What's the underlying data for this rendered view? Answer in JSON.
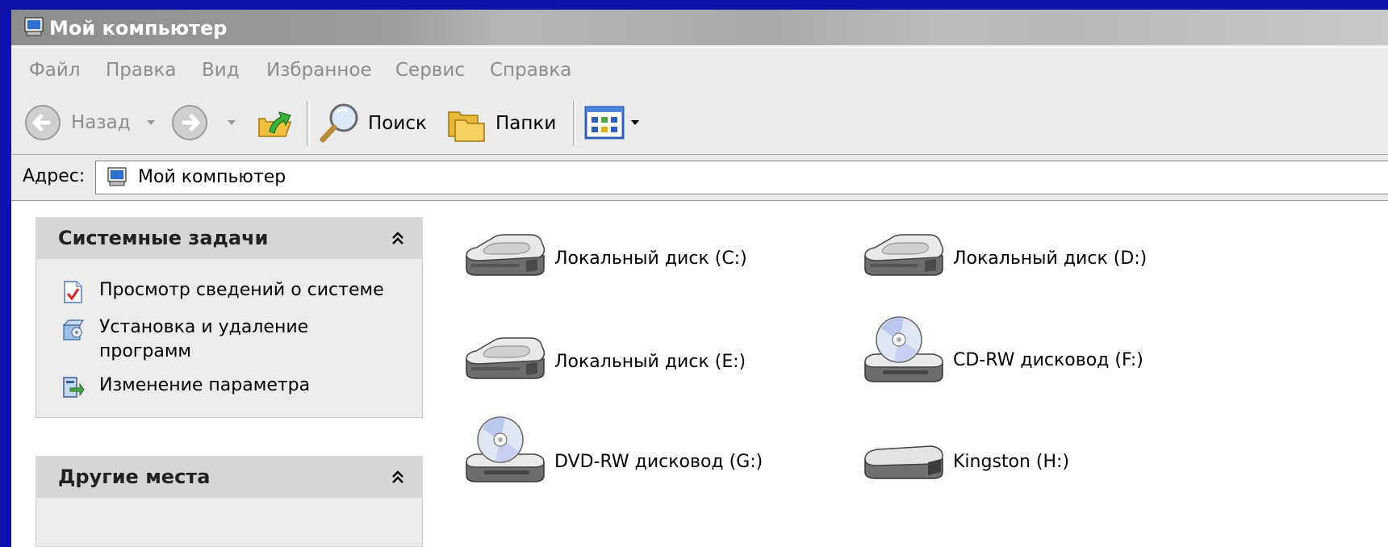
{
  "window": {
    "title": "Мой компьютер"
  },
  "menu": [
    "Файл",
    "Правка",
    "Вид",
    "Избранное",
    "Сервис",
    "Справка"
  ],
  "toolbar": {
    "back_label": "Назад",
    "search_label": "Поиск",
    "folders_label": "Папки"
  },
  "address": {
    "label": "Адрес:",
    "value": "Мой компьютер"
  },
  "panels": {
    "system_tasks": {
      "title": "Системные задачи",
      "items": [
        {
          "label": "Просмотр сведений о системе",
          "icon": "system-info-icon"
        },
        {
          "label": "Установка и удаление программ",
          "icon": "add-remove-programs-icon"
        },
        {
          "label": "Изменение параметра",
          "icon": "change-setting-icon"
        }
      ]
    },
    "other_places": {
      "title": "Другие места"
    }
  },
  "drives": [
    {
      "label": "Локальный диск (C:)",
      "icon": "hard-disk-icon"
    },
    {
      "label": "Локальный диск (D:)",
      "icon": "hard-disk-icon"
    },
    {
      "label": "Локальный диск (E:)",
      "icon": "hard-disk-icon"
    },
    {
      "label": "CD-RW дисковод (F:)",
      "icon": "cd-drive-icon"
    },
    {
      "label": "DVD-RW дисковод (G:)",
      "icon": "dvd-drive-icon"
    },
    {
      "label": "Kingston (H:)",
      "icon": "removable-disk-icon"
    }
  ],
  "colors": {
    "desktop": "#0f12a8",
    "titlebar": "#9e9e9e",
    "panel_header": "#d6d6d6",
    "content_bg": "#ffffff"
  }
}
